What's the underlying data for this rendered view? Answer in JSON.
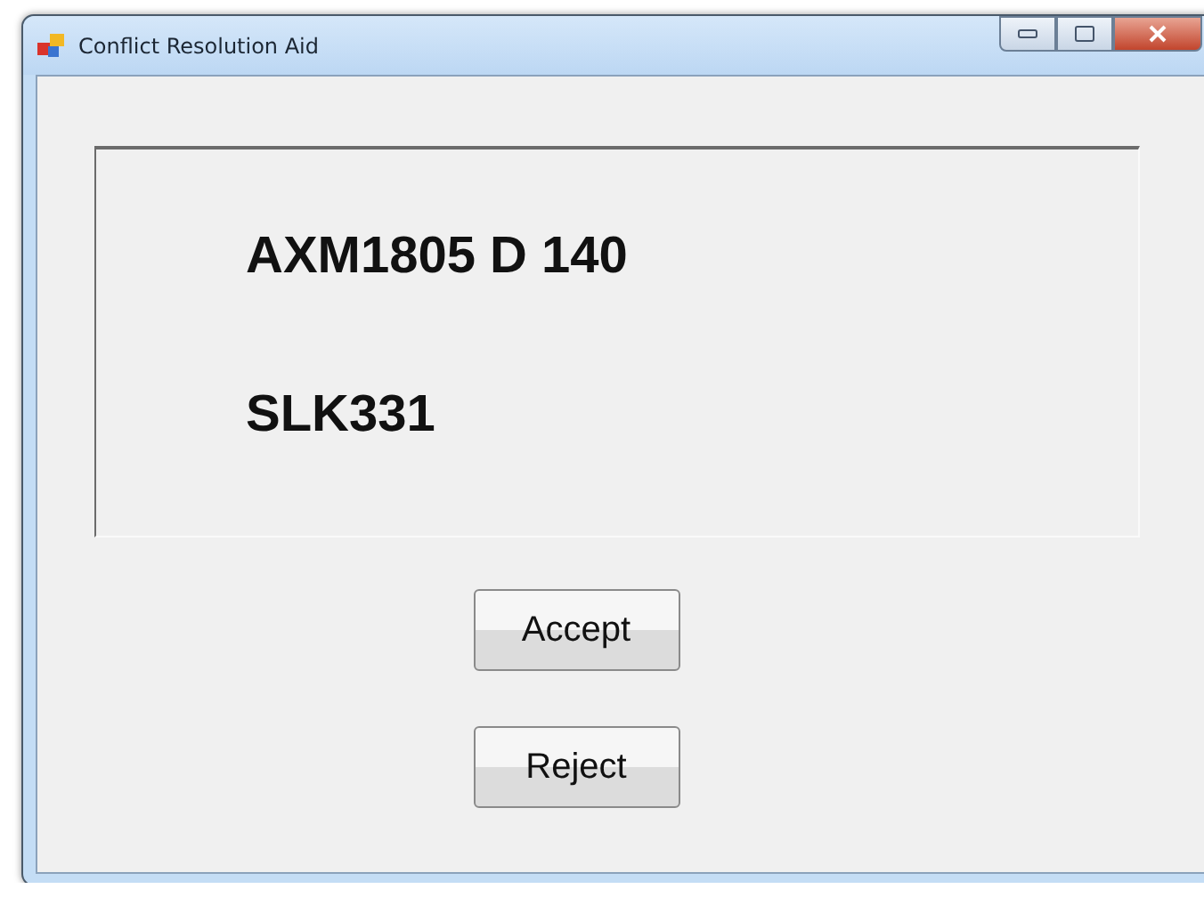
{
  "window": {
    "title": "Conflict Resolution Aid"
  },
  "panel": {
    "lines": [
      "AXM1805 D 140",
      "SLK331"
    ]
  },
  "buttons": [
    "Accept",
    "Reject"
  ]
}
